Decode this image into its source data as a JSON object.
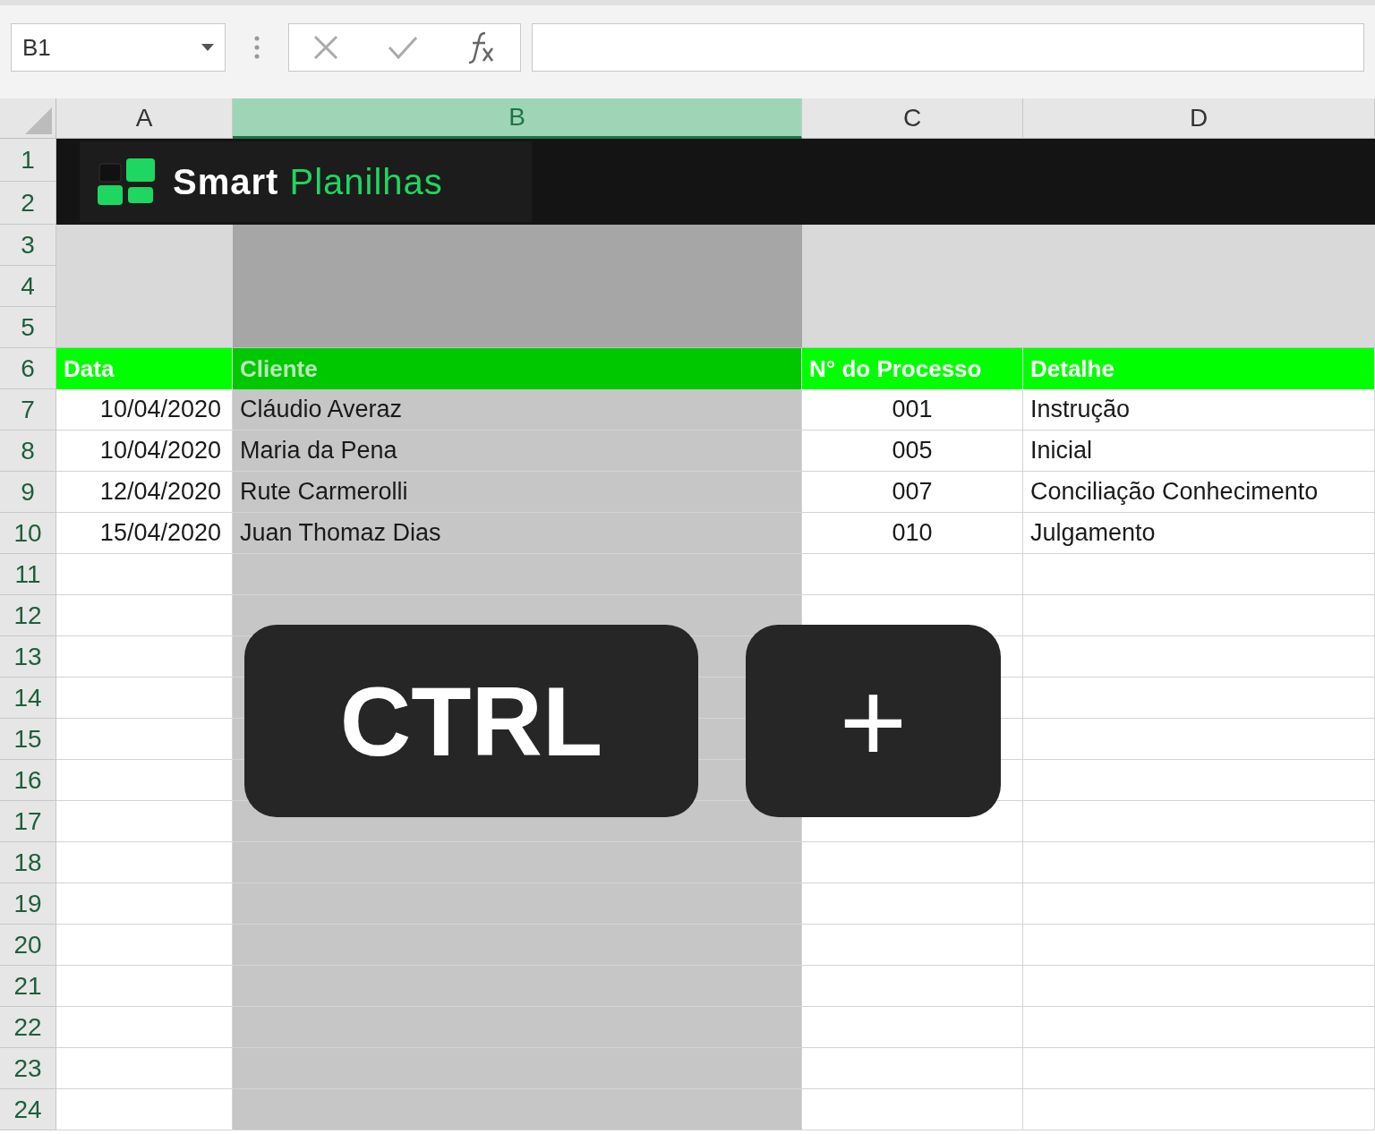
{
  "name_box": {
    "value": "B1"
  },
  "columns": [
    {
      "label": "A",
      "selected": false
    },
    {
      "label": "B",
      "selected": true
    },
    {
      "label": "C",
      "selected": false
    },
    {
      "label": "D",
      "selected": false
    }
  ],
  "row_numbers": [
    "1",
    "2",
    "3",
    "4",
    "5",
    "6",
    "7",
    "8",
    "9",
    "10",
    "11",
    "12",
    "13",
    "14",
    "15",
    "16",
    "17",
    "18",
    "19",
    "20",
    "21",
    "22",
    "23",
    "24"
  ],
  "banner": {
    "brand_first": "Smart",
    "brand_second": "Planilhas"
  },
  "table": {
    "columns": [
      "Data",
      "Cliente",
      "N° do Processo",
      "Detalhe"
    ],
    "rows": [
      [
        "10/04/2020",
        "Cláudio Averaz",
        "001",
        "Instrução"
      ],
      [
        "10/04/2020",
        "Maria da Pena",
        "005",
        "Inicial"
      ],
      [
        "12/04/2020",
        "Rute Carmerolli",
        "007",
        "Conciliação Conhecimento"
      ],
      [
        "15/04/2020",
        "Juan Thomaz Dias",
        "010",
        "Julgamento"
      ]
    ]
  },
  "keys": [
    "CTRL",
    "+"
  ]
}
